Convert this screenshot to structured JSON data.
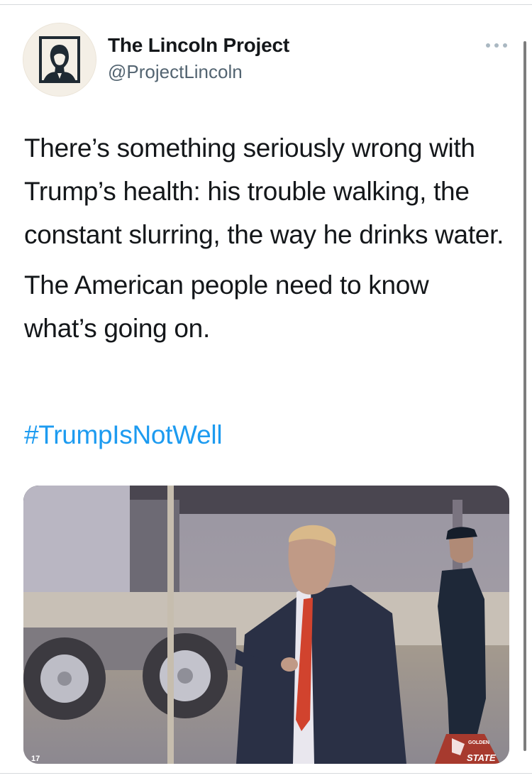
{
  "account": {
    "display_name": "The Lincoln Project",
    "handle": "@ProjectLincoln",
    "avatar_icon": "lincoln-portrait-avatar"
  },
  "tweet": {
    "paragraphs": [
      "There’s something seriously wrong with Trump’s health: his trouble walking, the constant slurring, the way he drinks water.",
      "The American people need to know what’s going on."
    ],
    "hashtag": "#TrumpIsNotWell"
  },
  "media": {
    "type": "video-still",
    "badge_small": "GOLDEN",
    "badge_text": "STATE",
    "corner_text": "17"
  },
  "icons": {
    "more": "more-options-icon"
  },
  "colors": {
    "text": "#14171a",
    "secondary": "#536471",
    "link": "#1d9bf0"
  }
}
